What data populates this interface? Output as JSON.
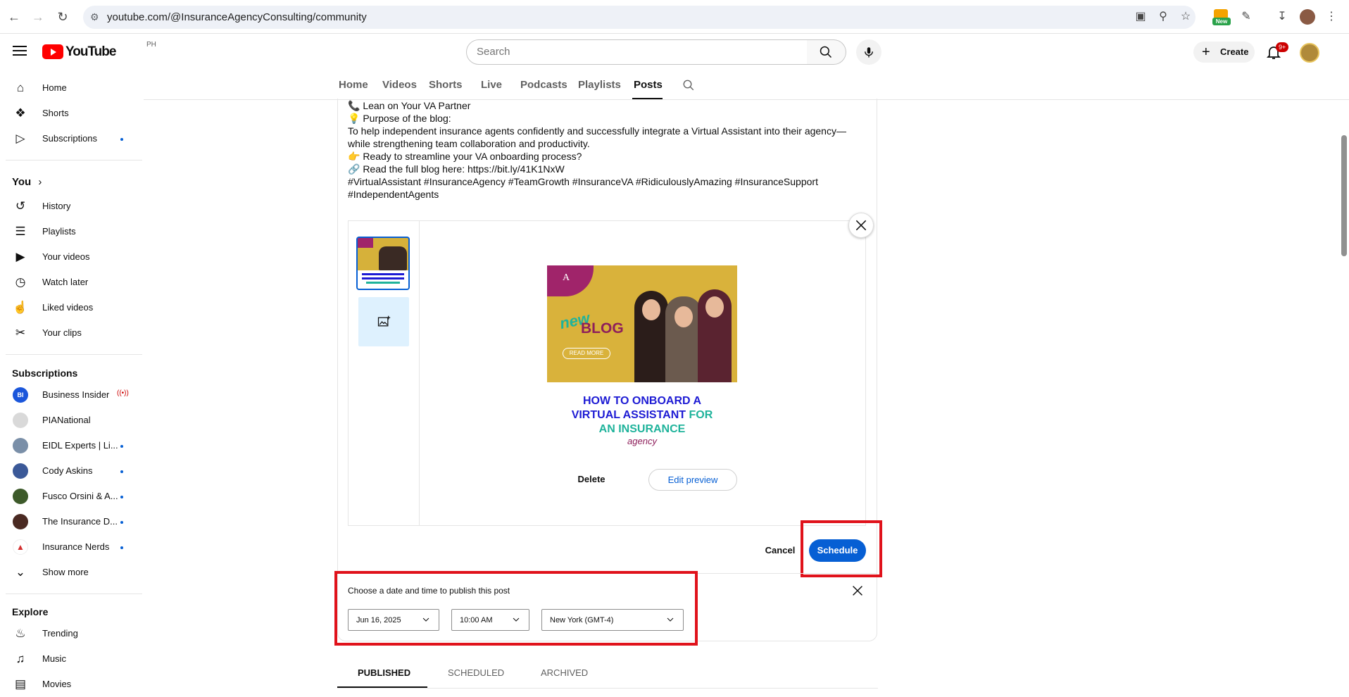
{
  "browser": {
    "url": "youtube.com/@InsuranceAgencyConsulting/community",
    "extension_badge": "New"
  },
  "header": {
    "logo_text": "YouTube",
    "country_code": "PH",
    "search_placeholder": "Search",
    "create_label": "Create",
    "notification_count": "9+"
  },
  "sidebar": {
    "main": [
      {
        "label": "Home",
        "icon": "home-icon"
      },
      {
        "label": "Shorts",
        "icon": "shorts-icon"
      },
      {
        "label": "Subscriptions",
        "icon": "subscriptions-icon"
      }
    ],
    "you_heading": "You",
    "you_items": [
      {
        "label": "History",
        "icon": "history-icon"
      },
      {
        "label": "Playlists",
        "icon": "playlists-icon"
      },
      {
        "label": "Your videos",
        "icon": "your-videos-icon"
      },
      {
        "label": "Watch later",
        "icon": "watch-later-icon"
      },
      {
        "label": "Liked videos",
        "icon": "liked-videos-icon"
      },
      {
        "label": "Your clips",
        "icon": "clips-icon"
      }
    ],
    "subscriptions_heading": "Subscriptions",
    "subscriptions": [
      {
        "label": "Business Insider",
        "initials": "BI",
        "color": "#1a56db"
      },
      {
        "label": "PIANational",
        "initials": "",
        "color": "#d9d9d9"
      },
      {
        "label": "EIDL Experts | Li...",
        "initials": "",
        "color": "#7a8fa8"
      },
      {
        "label": "Cody Askins",
        "initials": "",
        "color": "#3b5998"
      },
      {
        "label": "Fusco Orsini & A...",
        "initials": "",
        "color": "#3d5a2a"
      },
      {
        "label": "The Insurance D...",
        "initials": "",
        "color": "#4a2a22"
      },
      {
        "label": "Insurance Nerds",
        "initials": "",
        "color": "#ffffff"
      }
    ],
    "show_more": "Show more",
    "explore_heading": "Explore",
    "explore": [
      {
        "label": "Trending",
        "icon": "trending-icon"
      },
      {
        "label": "Music",
        "icon": "music-icon"
      },
      {
        "label": "Movies",
        "icon": "movies-icon"
      }
    ]
  },
  "channel_tabs": [
    "Home",
    "Videos",
    "Shorts",
    "Live",
    "Podcasts",
    "Playlists",
    "Posts"
  ],
  "post": {
    "lines": [
      "📞 Lean on Your VA Partner",
      "💡 Purpose of the blog:",
      "To help independent insurance agents confidently and successfully integrate a Virtual Assistant into their agency—",
      "while strengthening team collaboration and productivity.",
      "👉 Ready to streamline your VA onboarding process?",
      "🔗 Read the full blog here: https://bit.ly/41K1NxW",
      "#VirtualAssistant #InsuranceAgency #TeamGrowth #InsuranceVA #RidiculouslyAmazing #InsuranceSupport",
      "#IndependentAgents"
    ]
  },
  "preview_image": {
    "tag_new": "new",
    "tag_blog": "BLOG",
    "read_more": "READ MORE",
    "headline_line1": "HOW TO ONBOARD A",
    "headline_line2": "VIRTUAL ASSISTANT",
    "headline_for": "FOR",
    "headline_line3": "AN INSURANCE",
    "headline_agency": "agency"
  },
  "media_actions": {
    "delete": "Delete",
    "edit_preview": "Edit preview"
  },
  "actions": {
    "cancel": "Cancel",
    "schedule": "Schedule"
  },
  "schedule": {
    "label": "Choose a date and time to publish this post",
    "date": "Jun 16, 2025",
    "time": "10:00 AM",
    "timezone": "New York (GMT-4)"
  },
  "bottom_tabs": [
    "PUBLISHED",
    "SCHEDULED",
    "ARCHIVED"
  ],
  "colors": {
    "accent_blue": "#065fd4",
    "highlight_red": "#e0121b",
    "youtube_red": "#ff0000"
  }
}
